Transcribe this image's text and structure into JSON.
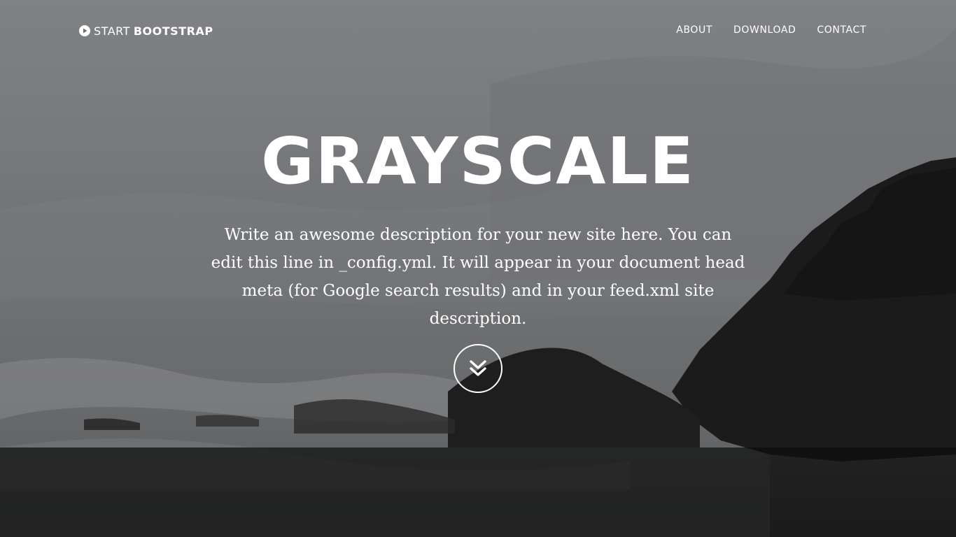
{
  "brand": {
    "icon": "play-circle-icon",
    "light": "START",
    "bold": "BOOTSTRAP"
  },
  "nav": {
    "items": [
      {
        "label": "ABOUT"
      },
      {
        "label": "DOWNLOAD"
      },
      {
        "label": "CONTACT"
      }
    ]
  },
  "hero": {
    "title": "GRAYSCALE",
    "description": "Write an awesome description for your new site here. You can edit this line in _config.yml. It will appear in your document head meta (for Google search results) and in your feed.xml site description.",
    "scroll_icon": "double-chevron-down-icon"
  },
  "colors": {
    "text": "#ffffff",
    "background": "#6e7073"
  }
}
